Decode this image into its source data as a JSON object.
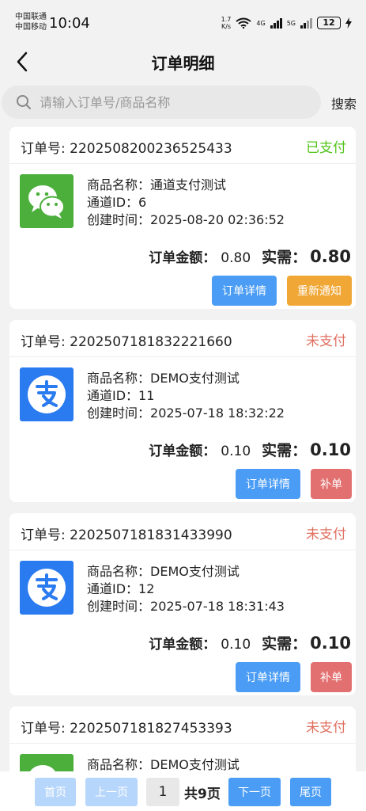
{
  "status_bar": {
    "carrier1": "中国联通",
    "carrier2": "中国移动",
    "time": "10:04",
    "net_speed_value": "1.7",
    "net_speed_unit": "K/s",
    "net_4g": "4G",
    "net_5g": "5G",
    "battery": "12"
  },
  "header": {
    "title": "订单明细"
  },
  "search": {
    "placeholder": "请输入订单号/商品名称",
    "button": "搜索"
  },
  "labels": {
    "order_no": "订单号: ",
    "product": "商品名称：",
    "channel": "通道ID：",
    "created": "创建时间：",
    "amount": "订单金额：",
    "need": "实需："
  },
  "orders": [
    {
      "order_no": "2202508200236525433",
      "status": "已支付",
      "payment_icon": "wechat-pay-icon",
      "product": "通道支付测试",
      "channel_id": "6",
      "created": "2025-08-20 02:36:52",
      "amount": "0.80",
      "need": "0.80",
      "btn_detail": "订单详情",
      "btn_action": "重新通知"
    },
    {
      "order_no": "2202507181832221660",
      "status": "未支付",
      "payment_icon": "alipay-icon",
      "product": "DEMO支付测试",
      "channel_id": "11",
      "created": "2025-07-18 18:32:22",
      "amount": "0.10",
      "need": "0.10",
      "btn_detail": "订单详情",
      "btn_action": "补单"
    },
    {
      "order_no": "2202507181831433990",
      "status": "未支付",
      "payment_icon": "alipay-icon",
      "product": "DEMO支付测试",
      "channel_id": "12",
      "created": "2025-07-18 18:31:43",
      "amount": "0.10",
      "need": "0.10",
      "btn_detail": "订单详情",
      "btn_action": "补单"
    },
    {
      "order_no": "2202507181827453393",
      "status": "未支付",
      "payment_icon": "wechat-pay-icon",
      "product": "DEMO支付测试"
    }
  ],
  "pagination": {
    "first": "首页",
    "prev": "上一页",
    "current": "1",
    "total": "共9页",
    "next": "下一页",
    "last": "尾页"
  },
  "colors": {
    "paid": "#52c41a",
    "unpaid": "#e07060",
    "primary": "#4a9cf5",
    "orange": "#f0a735",
    "red": "#e37070",
    "wechat": "#4caf3c",
    "alipay": "#2a7af0"
  }
}
